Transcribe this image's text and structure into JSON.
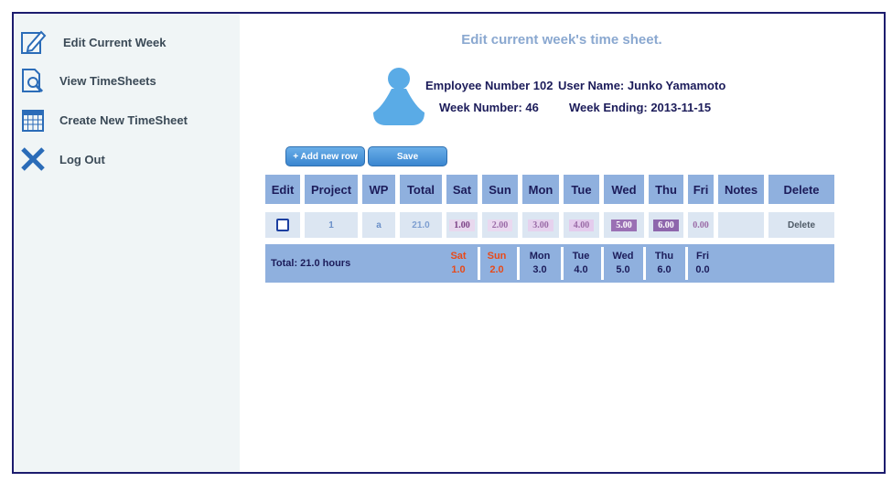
{
  "sidebar": {
    "items": [
      {
        "label": "Edit Current Week",
        "icon": "edit-icon"
      },
      {
        "label": "View TimeSheets",
        "icon": "document-search-icon"
      },
      {
        "label": "Create New TimeSheet",
        "icon": "calendar-icon"
      },
      {
        "label": "Log Out",
        "icon": "close-icon"
      }
    ]
  },
  "main": {
    "title": "Edit current week's time sheet.",
    "employee_number": "Employee Number 102",
    "user_name": "User Name: Junko Yamamoto",
    "week_number": "Week Number: 46",
    "week_ending": "Week Ending: 2013-11-15"
  },
  "toolbar": {
    "add_row_label": "+ Add new row",
    "save_label": "Save"
  },
  "table": {
    "headers": [
      "Edit",
      "Project",
      "WP",
      "Total",
      "Sat",
      "Sun",
      "Mon",
      "Tue",
      "Wed",
      "Thu",
      "Fri",
      "Notes",
      "Delete"
    ],
    "row": {
      "project": "1",
      "wp": "a",
      "total": "21.0",
      "sat": "1.00",
      "sun": "2.00",
      "mon": "3.00",
      "tue": "4.00",
      "wed": "5.00",
      "thu": "6.00",
      "fri": "0.00",
      "notes": "",
      "delete_label": "Delete"
    }
  },
  "totals": {
    "label": "Total: 21.0 hours",
    "days": [
      {
        "name": "Sat",
        "value": "1.0"
      },
      {
        "name": "Sun",
        "value": "2.0"
      },
      {
        "name": "Mon",
        "value": "3.0"
      },
      {
        "name": "Tue",
        "value": "4.0"
      },
      {
        "name": "Wed",
        "value": "5.0"
      },
      {
        "name": "Thu",
        "value": "6.0"
      },
      {
        "name": "Fri",
        "value": "0.0"
      }
    ]
  },
  "colors": {
    "border": "#1c1c6e",
    "sidebar_bg": "#f0f5f6",
    "header_bg": "#8fb0de",
    "cell_bg": "#dce6f2",
    "title": "#8aa8d0",
    "weekend_red": "#e74a1a",
    "avatar": "#5aabe6"
  }
}
